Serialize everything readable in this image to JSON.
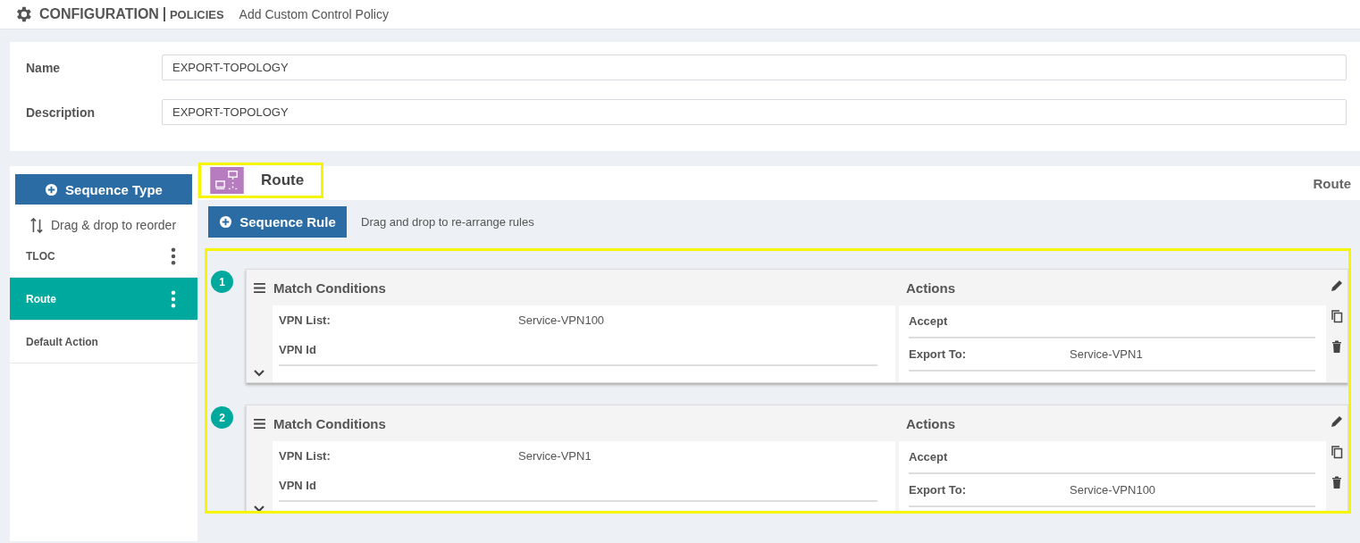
{
  "header": {
    "title": "CONFIGURATION",
    "section": "POLICIES",
    "page": "Add Custom Control Policy"
  },
  "form": [
    {
      "label": "Name",
      "value": "EXPORT-TOPOLOGY"
    },
    {
      "label": "Description",
      "value": "EXPORT-TOPOLOGY"
    }
  ],
  "sidebar": {
    "add_button": "Sequence Type",
    "hint": "Drag & drop to reorder",
    "items": [
      {
        "label": "TLOC",
        "selected": false,
        "menu": true
      },
      {
        "label": "Route",
        "selected": true,
        "menu": true
      },
      {
        "label": "Default Action",
        "selected": false,
        "menu": false
      }
    ]
  },
  "sequence": {
    "title": "Route",
    "type_label": "Route",
    "add_button": "Sequence Rule",
    "hint": "Drag and drop to re-arrange rules",
    "rules": [
      {
        "number": "1",
        "match_title": "Match Conditions",
        "conditions": [
          {
            "label": "VPN List:",
            "value": "Service-VPN100"
          },
          {
            "label": "VPN Id"
          }
        ],
        "actions_title": "Actions",
        "actions": [
          {
            "label": "Accept"
          },
          {
            "label": "Export To:",
            "value": "Service-VPN1"
          }
        ]
      },
      {
        "number": "2",
        "match_title": "Match Conditions",
        "conditions": [
          {
            "label": "VPN List:",
            "value": "Service-VPN1"
          },
          {
            "label": "VPN Id"
          }
        ],
        "actions_title": "Actions",
        "actions": [
          {
            "label": "Accept"
          },
          {
            "label": "Export To:",
            "value": "Service-VPN100"
          }
        ]
      }
    ]
  }
}
